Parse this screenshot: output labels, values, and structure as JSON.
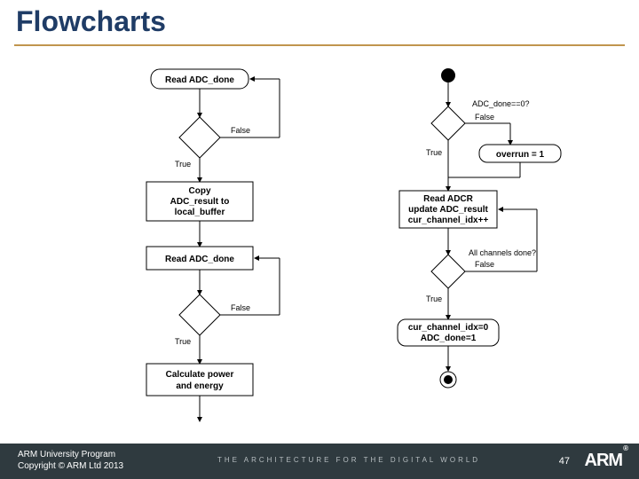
{
  "title": "Flowcharts",
  "left_chart": {
    "read1": "Read ADC_done",
    "d1_false": "False",
    "d1_true": "True",
    "copy1": "Copy",
    "copy2": "ADC_result to",
    "copy3": "local_buffer",
    "read2": "Read ADC_done",
    "d2_false": "False",
    "d2_true": "True",
    "calc1": "Calculate power",
    "calc2": "and energy"
  },
  "right_chart": {
    "q1": "ADC_done==0?",
    "false1": "False",
    "overrun": "overrun = 1",
    "true1": "True",
    "read1": "Read ADCR",
    "read2": "update ADC_result",
    "read3": "cur_channel_idx++",
    "q2": "All channels done?",
    "false2": "False",
    "true2": "True",
    "final1": "cur_channel_idx=0",
    "final2": "ADC_done=1"
  },
  "footer": {
    "credits1": "ARM University Program",
    "credits2": "Copyright © ARM Ltd 2013",
    "tagline": "THE ARCHITECTURE FOR THE DIGITAL WORLD",
    "page": "47",
    "logo": "ARM"
  }
}
